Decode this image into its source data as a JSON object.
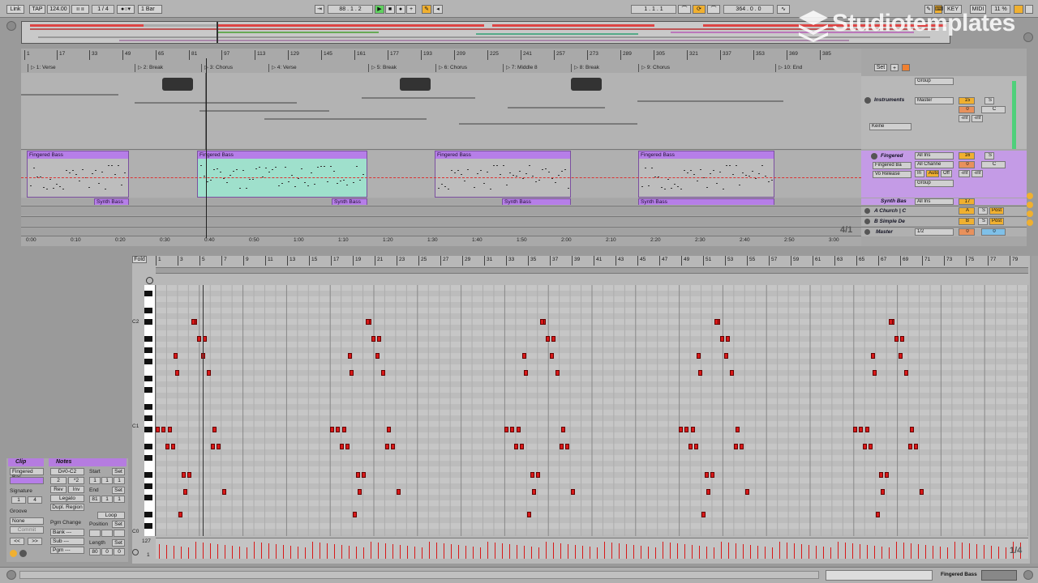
{
  "transport": {
    "link": "Link",
    "tap": "TAP",
    "tempo": "124.00",
    "time_sig": "1 / 4",
    "quantize": "1 Bar",
    "position": "88 .  1 .  2",
    "loop_start": "1 .  1 .  1",
    "loop_length": "364 .  0 .  0",
    "key": "KEY",
    "midi": "MIDI",
    "cpu": "11 %"
  },
  "brand": "Studiotemplates",
  "ruler_bars": [
    "1",
    "17",
    "33",
    "49",
    "65",
    "81",
    "97",
    "113",
    "129",
    "145",
    "161",
    "177",
    "193",
    "209",
    "225",
    "241",
    "257",
    "273",
    "289",
    "305",
    "321",
    "337",
    "353",
    "369",
    "385"
  ],
  "locators": [
    "1: Verse",
    "2: Break",
    "3: Chorus",
    "4: Verse",
    "5: Break",
    "6: Chorus",
    "7: Middle 8",
    "8: Break",
    "9: Chorus",
    "10: End"
  ],
  "time_ruler": [
    "0:00",
    "0:10",
    "0:20",
    "0:30",
    "0:40",
    "0:50",
    "1:00",
    "1:10",
    "1:20",
    "1:30",
    "1:40",
    "1:50",
    "2:00",
    "2:10",
    "2:20",
    "2:30",
    "2:40",
    "2:50",
    "3:00"
  ],
  "clips": [
    {
      "name": "Fingered Bass"
    },
    {
      "name": "Fingered Bass"
    },
    {
      "name": "Fingered Bass"
    },
    {
      "name": "Fingered Bass"
    }
  ],
  "synth_clips": [
    "Synth Bass",
    "Synth Bass",
    "Synth Bass",
    "Synth Bass"
  ],
  "mixer": {
    "set_label": "Set",
    "tracks": [
      {
        "name": "Instruments",
        "input": "Group",
        "output": "Master",
        "number": "15",
        "s": "S",
        "vol": "0",
        "pan": "C",
        "inf1": "-inf",
        "inf2": "-inf"
      },
      {
        "name": "Fingered",
        "input": "All Ins",
        "channel": "All Channe",
        "instrument": "Fingered Ba",
        "preset": "Vo Release",
        "output": "Group",
        "number": "16",
        "s": "S",
        "vol": "0",
        "pan": "C",
        "inf1": "-inf",
        "inf2": "-inf",
        "mon_in": "In",
        "mon_auto": "Auto",
        "mon_off": "Off"
      },
      {
        "name": "Synth Bas",
        "input": "All Ins",
        "number": "17"
      },
      {
        "name": "A Church | C",
        "send": "A",
        "s": "S",
        "post": "Post"
      },
      {
        "name": "B Simple De",
        "send": "B",
        "s": "S",
        "post": "Post"
      },
      {
        "name": "Master",
        "output": "1/2",
        "vol": "0",
        "pan": "0"
      }
    ],
    "keine": "Keine",
    "page": "4/1"
  },
  "clip_panel": {
    "clip_title": "Clip",
    "notes_title": "Notes",
    "clip_name": "Fingered Bas",
    "signature_label": "Signature",
    "sig_num": "1",
    "sig_den": "4",
    "groove_label": "Groove",
    "groove_value": "None",
    "commit": "Commit",
    "range": "D#0-C2",
    "half": "2",
    "double": "*2",
    "rev": "Rev",
    "inv": "Inv",
    "legato": "Legato",
    "dupl": "Dupl. Region",
    "start_label": "Start",
    "start_val": [
      "1",
      "1",
      "1"
    ],
    "end_label": "End",
    "end_val": [
      "81",
      "1",
      "1"
    ],
    "loop": "Loop",
    "position_label": "Position",
    "length_label": "Length",
    "length_val": [
      "80",
      "0",
      "0"
    ],
    "pgm_change": "Pgm Change",
    "bank": "Bank ---",
    "sub": "Sub ---",
    "pgm": "Pgm ---",
    "set": "Set"
  },
  "editor": {
    "fold": "Fold",
    "bars": [
      "1",
      "3",
      "5",
      "7",
      "9",
      "11",
      "13",
      "15",
      "17",
      "19",
      "21",
      "23",
      "25",
      "27",
      "29",
      "31",
      "33",
      "35",
      "37",
      "39",
      "41",
      "43",
      "45",
      "47",
      "49",
      "51",
      "53",
      "55",
      "57",
      "59",
      "61",
      "63",
      "65",
      "67",
      "69",
      "71",
      "73",
      "75",
      "77",
      "79"
    ],
    "pitch_labels": [
      "C2",
      "C1",
      "C0"
    ],
    "vel_top": "127",
    "vel_bottom": "1",
    "page": "1/4"
  },
  "status": {
    "track_name": "Fingered Bass"
  },
  "colors": {
    "clip": "#b67ee8",
    "note": "#d81818",
    "orange": "#f0b030",
    "selected": "#9fe0cc"
  }
}
